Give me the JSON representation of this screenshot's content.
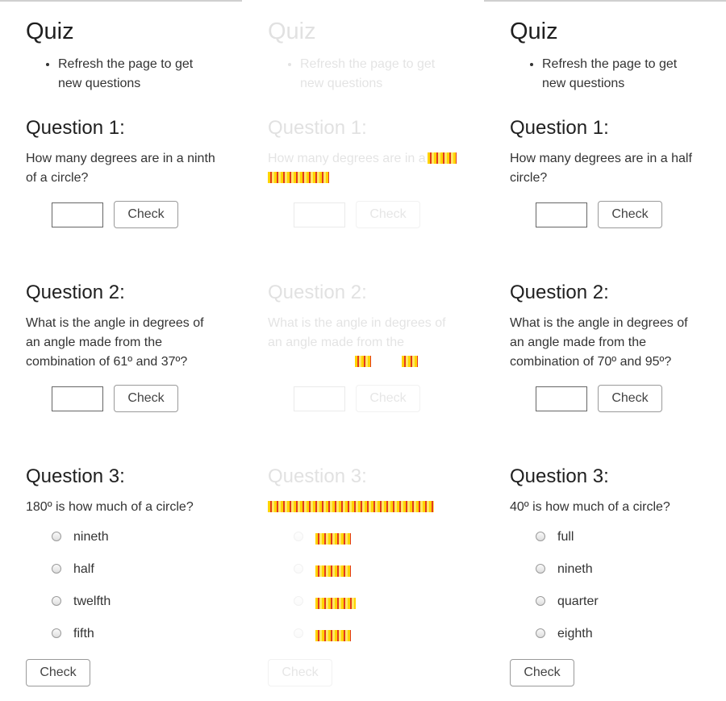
{
  "columns": [
    {
      "title": "Quiz",
      "instructions": [
        "Refresh the page to get new questions"
      ],
      "questions": [
        {
          "heading": "Question 1:",
          "text": "How many degrees are in a ninth of a circle?",
          "check_label": "Check"
        },
        {
          "heading": "Question 2:",
          "text": "What is the angle in degrees of an angle made from the combination of 61º and 37º?",
          "check_label": "Check"
        },
        {
          "heading": "Question 3:",
          "text": "180º is how much of a circle?",
          "options": [
            "nineth",
            "half",
            "twelfth",
            "fifth"
          ],
          "check_label": "Check"
        }
      ]
    },
    {
      "title": "Quiz",
      "instructions": [
        "Refresh the page to get new questions"
      ],
      "questions": [
        {
          "heading": "Question 1:",
          "text": "How many degrees are in a",
          "check_label": "Check"
        },
        {
          "heading": "Question 2:",
          "text": "What is the angle in degrees of an angle made from the",
          "check_label": "Check"
        },
        {
          "heading": "Question 3:",
          "text": "",
          "options": [
            "",
            "",
            "",
            ""
          ],
          "check_label": "Check"
        }
      ]
    },
    {
      "title": "Quiz",
      "instructions": [
        "Refresh the page to get new questions"
      ],
      "questions": [
        {
          "heading": "Question 1:",
          "text": "How many degrees are in a half circle?",
          "check_label": "Check"
        },
        {
          "heading": "Question 2:",
          "text": "What is the angle in degrees of an angle made from the combination of 70º and 95º?",
          "check_label": "Check"
        },
        {
          "heading": "Question 3:",
          "text": "40º is how much of a circle?",
          "options": [
            "full",
            "nineth",
            "quarter",
            "eighth"
          ],
          "check_label": "Check"
        }
      ]
    }
  ],
  "colors": {
    "text": "#1f1f1f",
    "border": "#9a9a9a",
    "glitch": "#ffd400"
  }
}
